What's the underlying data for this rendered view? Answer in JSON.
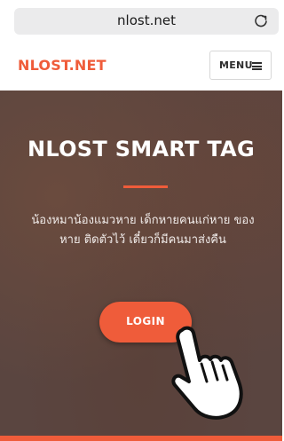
{
  "browser": {
    "url": "nlost.net",
    "reload_icon": "reload-icon"
  },
  "header": {
    "brand": "NLOST.NET",
    "menu_label": "MENU",
    "menu_icon": "hamburger-icon"
  },
  "hero": {
    "title": "NLOST SMART TAG",
    "description_line1": "น้องหมาน้องแมวหาย เด็กหายคนแก่หาย ของ",
    "description_line2": "หาย ติดตัวไว้ เดี๋ยวก็มีคนมาส่งคืน",
    "login_label": "LOGIN",
    "pointer_icon": "hand-pointer-icon"
  },
  "colors": {
    "accent": "#ef5c3a",
    "hero_bg": "#5a4540"
  }
}
